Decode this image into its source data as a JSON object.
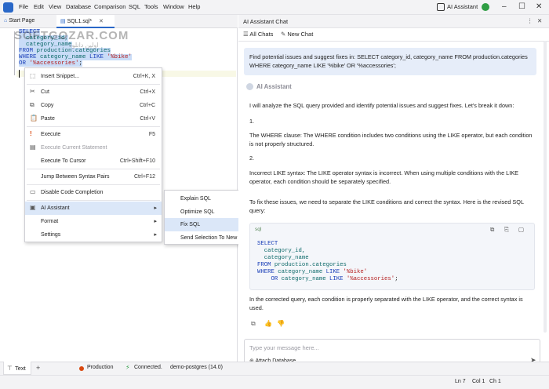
{
  "menubar": {
    "items": [
      "File",
      "Edit",
      "View",
      "Database",
      "Comparison",
      "SQL",
      "Tools",
      "Window",
      "Help"
    ],
    "ai_assistant_label": "AI Assistant"
  },
  "tabs": [
    {
      "label": "Start Page"
    },
    {
      "label": "SQL1.sql*"
    }
  ],
  "watermark": {
    "main": "SOFTGOZAR.COM",
    "sub": "اولین دانلود"
  },
  "editor": {
    "lines": [
      {
        "parts": [
          {
            "t": "SELECT",
            "c": "kw"
          }
        ]
      },
      {
        "parts": [
          {
            "t": "  category_id,",
            "c": "ident"
          }
        ]
      },
      {
        "parts": [
          {
            "t": "  category_name",
            "c": "ident"
          }
        ]
      },
      {
        "parts": [
          {
            "t": "FROM ",
            "c": "kw"
          },
          {
            "t": "production.categories",
            "c": "ident"
          }
        ]
      },
      {
        "parts": [
          {
            "t": "WHERE ",
            "c": "kw"
          },
          {
            "t": "category_name ",
            "c": "ident"
          },
          {
            "t": "LIKE ",
            "c": "kw"
          },
          {
            "t": "'%bike'",
            "c": "str"
          }
        ]
      },
      {
        "parts": [
          {
            "t": "OR ",
            "c": "kw"
          },
          {
            "t": "'%accessories'",
            "c": "str"
          },
          {
            "t": ";",
            "c": ""
          }
        ]
      }
    ]
  },
  "context_menu": {
    "items": [
      {
        "label": "Insert Snippet...",
        "shortcut": "Ctrl+K, X",
        "icon": "snippet-icon",
        "glyph": "⬚"
      },
      {
        "sep": true
      },
      {
        "label": "Cut",
        "shortcut": "Ctrl+X",
        "icon": "cut-icon",
        "glyph": "✂"
      },
      {
        "label": "Copy",
        "shortcut": "Ctrl+C",
        "icon": "copy-icon",
        "glyph": "⧉"
      },
      {
        "label": "Paste",
        "shortcut": "Ctrl+V",
        "icon": "paste-icon",
        "glyph": "📋"
      },
      {
        "sep": true
      },
      {
        "label": "Execute",
        "shortcut": "F5",
        "icon": "execute-icon",
        "glyph": "!"
      },
      {
        "label": "Execute Current Statement",
        "shortcut": "",
        "icon": "execute-statement-icon",
        "glyph": "▤",
        "disabled": true
      },
      {
        "label": "Execute To Cursor",
        "shortcut": "Ctrl+Shift+F10",
        "icon": "",
        "glyph": ""
      },
      {
        "sep": true
      },
      {
        "label": "Jump Between Syntax Pairs",
        "shortcut": "Ctrl+F12",
        "icon": "",
        "glyph": ""
      },
      {
        "sep": true
      },
      {
        "label": "Disable Code Completion",
        "shortcut": "",
        "icon": "code-completion-icon",
        "glyph": "▭"
      },
      {
        "sep": true
      },
      {
        "label": "AI Assistant",
        "shortcut": "",
        "icon": "ai-icon",
        "glyph": "▣",
        "submenu": true,
        "highlight": true
      },
      {
        "label": "Format",
        "shortcut": "",
        "icon": "",
        "glyph": "",
        "submenu": true
      },
      {
        "label": "Settings",
        "shortcut": "",
        "icon": "",
        "glyph": "",
        "submenu": true
      }
    ]
  },
  "submenu": {
    "items": [
      {
        "label": "Explain SQL"
      },
      {
        "label": "Optimize SQL"
      },
      {
        "label": "Fix SQL",
        "highlight": true
      },
      {
        "label": "Send Selection To New Chat"
      }
    ]
  },
  "ai_panel": {
    "title": "AI Assistant Chat",
    "all_chats": "All Chats",
    "new_chat": "New Chat",
    "user_prompt": "Find potential issues and suggest fixes in: SELECT category_id, category_name FROM production.categories WHERE category_name LIKE '%bike' OR '%accessories';",
    "assistant_label": "AI Assistant",
    "paragraphs": [
      "I will analyze the SQL query provided and identify potential issues and suggest fixes. Let's break it down:",
      "1.",
      "The WHERE clause: The WHERE condition includes two conditions using the LIKE operator, but each condition is not properly structured.",
      "2.",
      "Incorrect LIKE syntax: The LIKE operator syntax is incorrect. When using multiple conditions with the LIKE operator, each condition should be separately specified.",
      "To fix these issues, we need to separate the LIKE conditions and correct the syntax. Here is the revised SQL query:"
    ],
    "code_lang": "sql",
    "code_lines": [
      {
        "parts": [
          {
            "t": "SELECT",
            "c": "kw"
          }
        ]
      },
      {
        "parts": [
          {
            "t": "  category_id,",
            "c": "ident"
          }
        ]
      },
      {
        "parts": [
          {
            "t": "  category_name",
            "c": "ident"
          }
        ]
      },
      {
        "parts": [
          {
            "t": "FROM ",
            "c": "kw"
          },
          {
            "t": "production.categories",
            "c": "ident"
          }
        ]
      },
      {
        "parts": [
          {
            "t": "WHERE ",
            "c": "kw"
          },
          {
            "t": "category_name ",
            "c": "ident"
          },
          {
            "t": "LIKE ",
            "c": "kw"
          },
          {
            "t": "'%bike'",
            "c": "str"
          }
        ]
      },
      {
        "parts": [
          {
            "t": "    OR ",
            "c": "kw"
          },
          {
            "t": "category_name ",
            "c": "ident"
          },
          {
            "t": "LIKE ",
            "c": "kw"
          },
          {
            "t": "'%accessories'",
            "c": "str"
          },
          {
            "t": ";",
            "c": ""
          }
        ]
      }
    ],
    "closing": "In the corrected query, each condition is properly separated with the LIKE operator, and the correct syntax is used.",
    "input_placeholder": "Type your message here...",
    "attach_label": "Attach Database"
  },
  "status": {
    "text_tab": "Text",
    "env": "Production",
    "connection": "Connected.",
    "database": "demo-postgres (14.0)",
    "ln": "Ln 7",
    "col": "Col 1",
    "ch": "Ch 1"
  },
  "colors": {
    "accent": "#2a68c8",
    "production": "#d9480f",
    "connected": "#2f9e44"
  }
}
